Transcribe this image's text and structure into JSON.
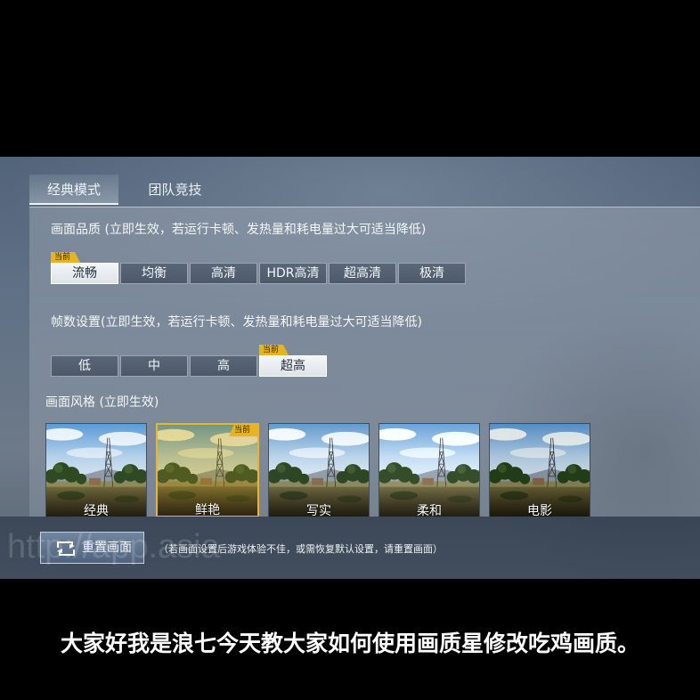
{
  "tabs": [
    {
      "label": "经典模式",
      "active": true
    },
    {
      "label": "团队竞技",
      "active": false
    }
  ],
  "quality": {
    "title": "画面品质 (立即生效，若运行卡顿、发热量和耗电量过大可适当降低)",
    "current_tag": "当前",
    "options": [
      {
        "label": "流畅",
        "current": true
      },
      {
        "label": "均衡",
        "current": false
      },
      {
        "label": "高清",
        "current": false
      },
      {
        "label": "HDR高清",
        "current": false
      },
      {
        "label": "超高清",
        "current": false
      },
      {
        "label": "极清",
        "current": false
      }
    ]
  },
  "fps": {
    "title": "帧数设置(立即生效，若运行卡顿、发热量和耗电量过大可适当降低)",
    "current_tag": "当前",
    "options": [
      {
        "label": "低",
        "current": false
      },
      {
        "label": "中",
        "current": false
      },
      {
        "label": "高",
        "current": false
      },
      {
        "label": "超高",
        "current": true
      }
    ]
  },
  "style": {
    "title": "画面风格 (立即生效)",
    "current_tag": "当前",
    "thumbnail_icon": "landscape-thumbnail",
    "options": [
      {
        "label": "经典",
        "current": false
      },
      {
        "label": "鲜艳",
        "current": true
      },
      {
        "label": "写实",
        "current": false
      },
      {
        "label": "柔和",
        "current": false
      },
      {
        "label": "电影",
        "current": false
      }
    ]
  },
  "reset": {
    "label": "重置画面",
    "icon": "reset-icon",
    "hint": "（若画面设置后游戏体验不佳，或需恢复默认设置，请重置画面）"
  },
  "watermark": "http://app.asia",
  "subtitle": "大家好我是浪七今天教大家如何使用画质星修改吃鸡画质。",
  "colors": {
    "current_tag": "#e6b422",
    "selected_option_bg": "#e9edf0",
    "selected_style_border": "#e7b62a",
    "panel": "#66768a",
    "background": "#000000",
    "subtitle": "#ffffff"
  }
}
